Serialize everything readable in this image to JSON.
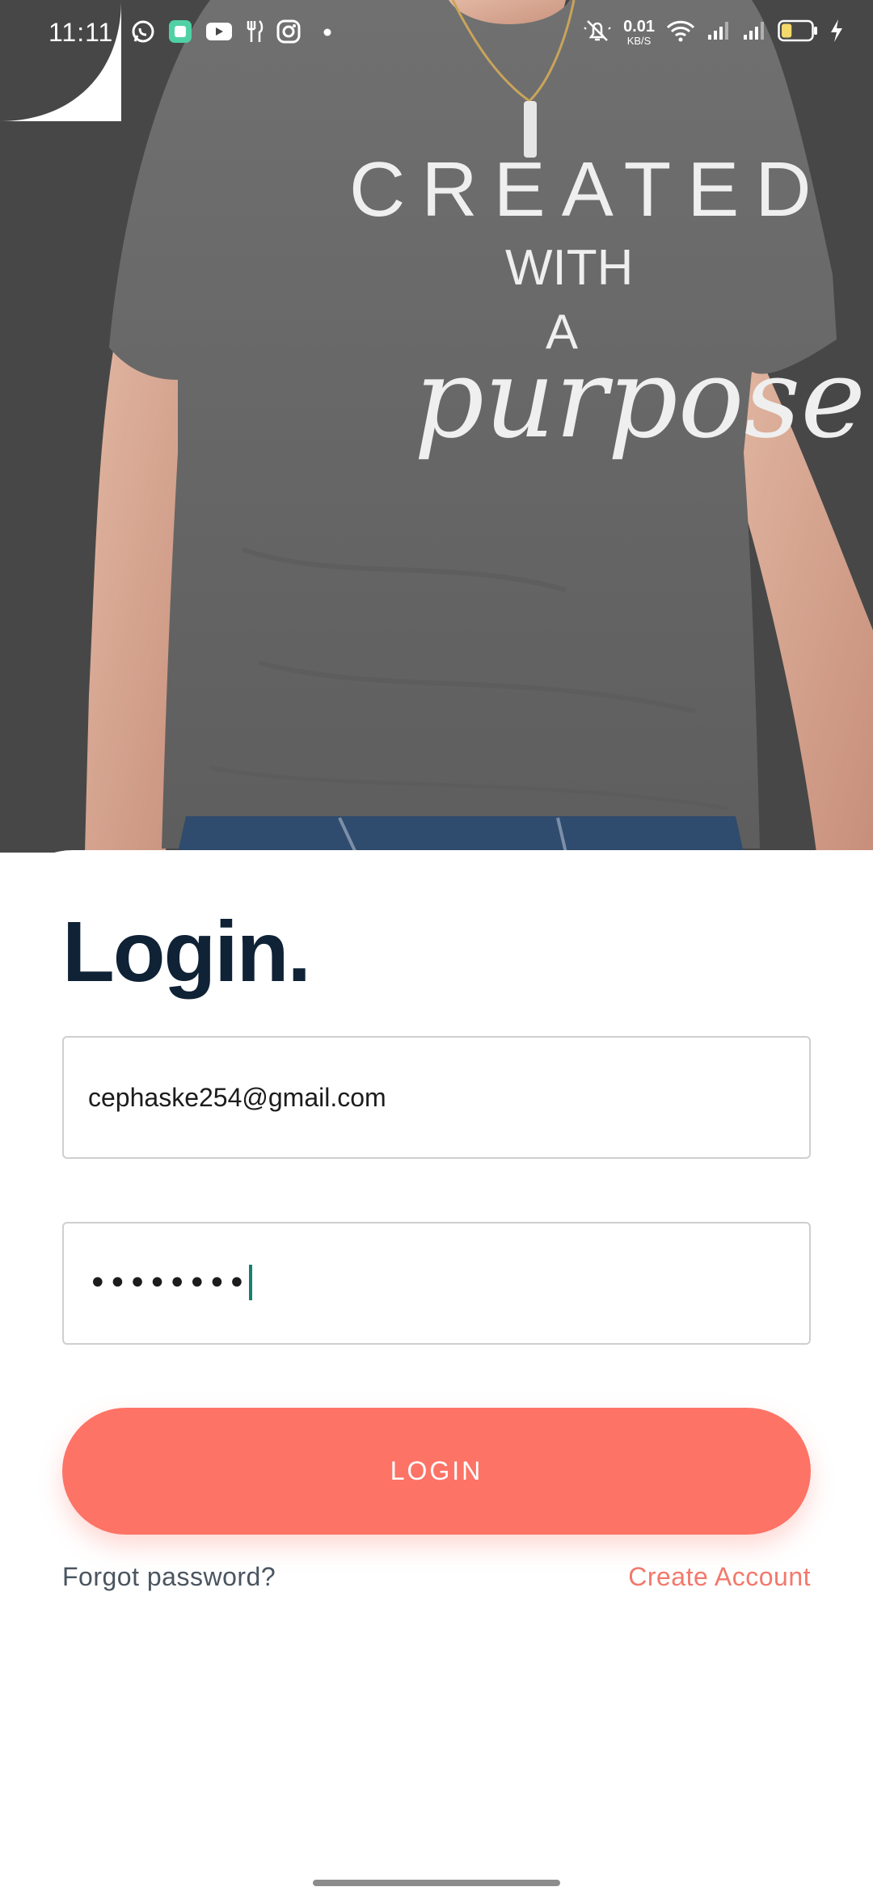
{
  "status_bar": {
    "time": "11:11",
    "left_icons": [
      "whatsapp-icon",
      "app-icon",
      "youtube-icon",
      "restaurant-icon",
      "instagram-icon",
      "dot-icon"
    ],
    "net_speed_value": "0.01",
    "net_speed_unit": "KB/S",
    "right_icons": [
      "silent-icon",
      "wifi-icon",
      "signal-icon",
      "signal-icon",
      "battery-icon",
      "charging-icon"
    ],
    "battery_level": 0.35
  },
  "hero": {
    "shirt_line1": "CREATED",
    "shirt_line2": "WITH",
    "shirt_line3": "A",
    "shirt_line4": "purpose"
  },
  "login": {
    "title": "Login.",
    "email_value": "cephaske254@gmail.com",
    "password_mask": "••••••••",
    "login_button": "LOGIN",
    "forgot_link": "Forgot password?",
    "create_link": "Create Account"
  },
  "colors": {
    "accent": "#fd7366",
    "title": "#0f2236",
    "hero_bg": "#474747",
    "caret": "#17806f"
  }
}
